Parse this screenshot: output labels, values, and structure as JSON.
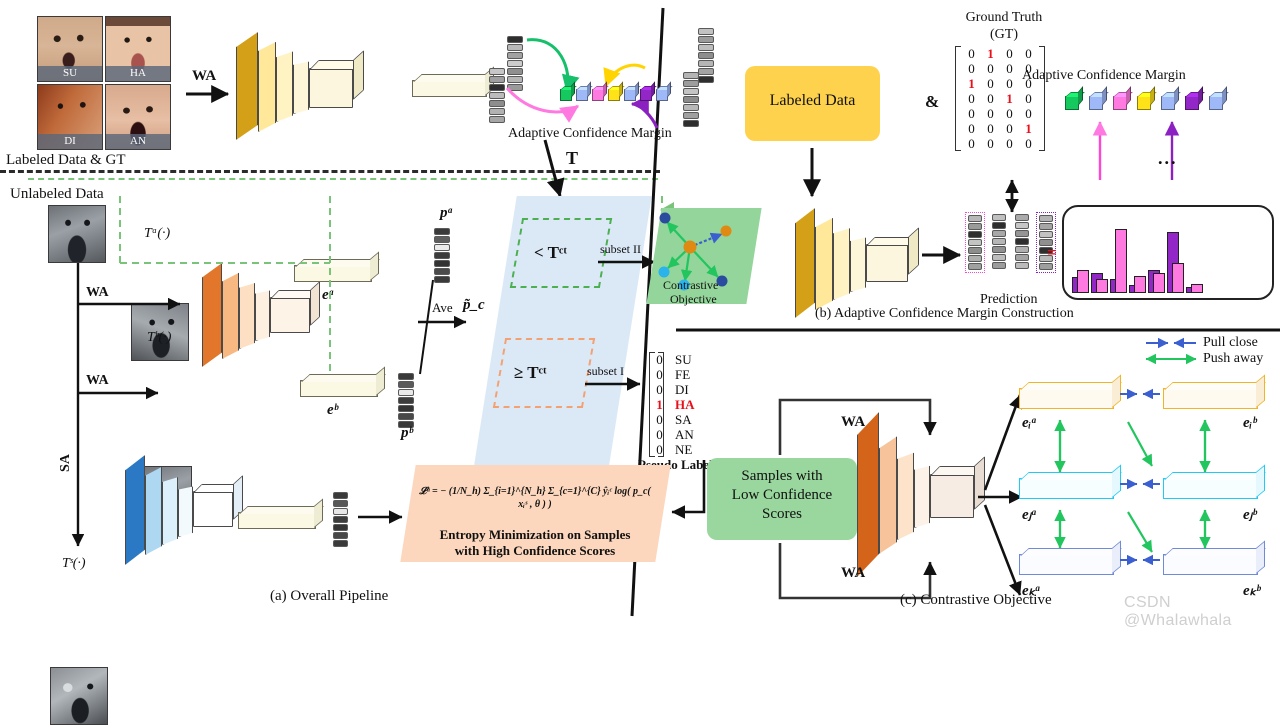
{
  "figure": {
    "captions": {
      "a": "(a) Overall Pipeline",
      "b": "(b) Adaptive Confidence Margin Construction",
      "c": "(c) Contrastive Objective"
    },
    "watermark": "CSDN @Whalawhala"
  },
  "panel_a": {
    "labeled_data_caption": "Labeled Data & GT",
    "labeled_faces": [
      {
        "label": "SU",
        "emotion": "Surprise"
      },
      {
        "label": "HA",
        "emotion": "Happy"
      },
      {
        "label": "DI",
        "emotion": "Disgust"
      },
      {
        "label": "AN",
        "emotion": "Anger"
      }
    ],
    "unlabeled_data_caption": "Unlabeled Data",
    "aug_labels": {
      "wa1": "WA",
      "wa2": "WA",
      "wa3": "WA",
      "sa": "SA",
      "t_a": "Tᵃ(·)",
      "t_b": "Tᵇ(·)",
      "t_s": "Tˢ(·)"
    },
    "margin_label": "Adaptive Confidence Margin",
    "threshold_symbol": "T",
    "feature_labels": {
      "e_a": "eᵃ",
      "e_b": "eᵇ",
      "p_a": "pᵃ",
      "p_b": "pᵇ",
      "p_tilde": "p̃_c"
    },
    "ave_label": "Ave",
    "threshold_low": "< Tᶜᵗ",
    "threshold_high": "≥ Tᶜᵗ",
    "subset_two": "subset II",
    "subset_one": "subset I",
    "contrastive_box": {
      "line1": "Contrastive",
      "line2": "Objective"
    },
    "pseudo_label": {
      "title": "Pseudo Label",
      "rows": [
        {
          "value": "0",
          "name": "SU",
          "active": false
        },
        {
          "value": "0",
          "name": "FE",
          "active": false
        },
        {
          "value": "0",
          "name": "DI",
          "active": false
        },
        {
          "value": "1",
          "name": "HA",
          "active": true
        },
        {
          "value": "0",
          "name": "SA",
          "active": false
        },
        {
          "value": "0",
          "name": "AN",
          "active": false
        },
        {
          "value": "0",
          "name": "NE",
          "active": false
        }
      ]
    },
    "loss_box": {
      "formula": "𝓛ᵘ = − (1/N_h) Σ_{i=1}^{N_h} Σ_{c=1}^{C} ŷᵢᶜ log( p_c( xᵢˢ , θ ) )",
      "caption_line1": "Entropy Minimization on Samples",
      "caption_line2": "with High Confidence Scores"
    },
    "margin_cube_colors": [
      "#16c95e",
      "#9fb8f7",
      "#ff7ae0",
      "#ffe218",
      "#9fb8f7",
      "#9326c6",
      "#9fb8f7"
    ]
  },
  "panel_b": {
    "labeled_data_box": "Labeled Data",
    "amp_symbol": "&",
    "ground_truth_title_line1": "Ground Truth",
    "ground_truth_title_line2": "(GT)",
    "ground_truth_matrix": [
      [
        "0",
        "1",
        "0",
        "0"
      ],
      [
        "0",
        "0",
        "0",
        "0"
      ],
      [
        "1",
        "0",
        "0",
        "0"
      ],
      [
        "0",
        "0",
        "1",
        "0"
      ],
      [
        "0",
        "0",
        "0",
        "0"
      ],
      [
        "0",
        "0",
        "0",
        "1"
      ],
      [
        "0",
        "0",
        "0",
        "0"
      ]
    ],
    "prediction_label": "Prediction",
    "equals_symbol": "=",
    "margin_title": "Adaptive Confidence Margin",
    "margin_cube_colors": [
      "#16c95e",
      "#9fb8f7",
      "#ff7ae0",
      "#ffe218",
      "#9fb8f7",
      "#9326c6",
      "#9fb8f7"
    ],
    "ellipsis": "...",
    "histogram": {
      "pink_values": [
        12,
        30,
        18,
        22,
        62,
        14,
        20,
        26,
        38,
        10
      ],
      "purple_values": [
        20,
        16,
        26,
        14,
        18,
        10,
        30,
        12,
        58,
        8
      ]
    }
  },
  "panel_c": {
    "low_conf_box": {
      "line1": "Samples with",
      "line2": "Low Confidence",
      "line3": "Scores"
    },
    "wa_top": "WA",
    "wa_bottom": "WA",
    "legend": [
      {
        "label": "Pull close",
        "color": "#3b5fd0"
      },
      {
        "label": "Push away",
        "color": "#22c55e"
      }
    ],
    "embeddings": [
      {
        "left": "eᵢᵃ",
        "right": "eᵢᵇ",
        "color": "#f0b429"
      },
      {
        "left": "eⱼᵃ",
        "right": "eⱼᵇ",
        "color": "#22c9f0"
      },
      {
        "left": "eₖᵃ",
        "right": "eₖᵇ",
        "color": "#6f8bd8"
      }
    ]
  }
}
